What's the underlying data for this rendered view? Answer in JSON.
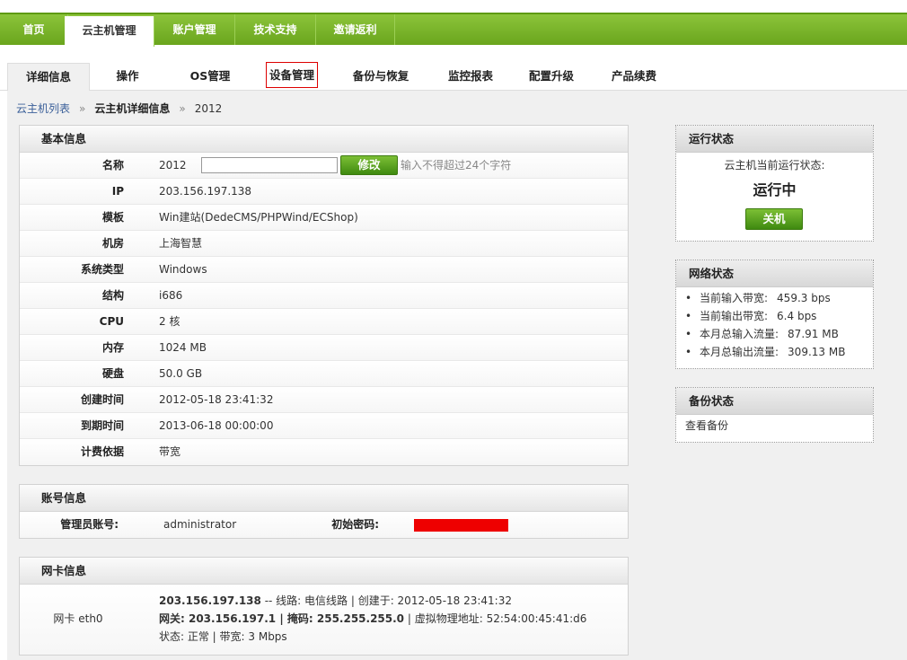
{
  "topnav": {
    "items": [
      {
        "label": "首页"
      },
      {
        "label": "云主机管理"
      },
      {
        "label": "账户管理"
      },
      {
        "label": "技术支持"
      },
      {
        "label": "邀请返利"
      }
    ]
  },
  "tabs": [
    {
      "label": "详细信息"
    },
    {
      "label": "操作"
    },
    {
      "label": "OS管理"
    },
    {
      "label": "设备管理"
    },
    {
      "label": "备份与恢复"
    },
    {
      "label": "监控报表"
    },
    {
      "label": "配置升级"
    },
    {
      "label": "产品续费"
    }
  ],
  "breadcrumb": {
    "root": "云主机列表",
    "sep": "»",
    "detail": "云主机详细信息",
    "current": "2012"
  },
  "basic": {
    "title": "基本信息",
    "name_label": "名称",
    "name_value": "2012",
    "name_input": "",
    "modify_button": "修改",
    "hint": "输入不得超过24个字符",
    "rows": [
      {
        "label": "IP",
        "value": "203.156.197.138"
      },
      {
        "label": "模板",
        "value": "Win建站(DedeCMS/PHPWind/ECShop)"
      },
      {
        "label": "机房",
        "value": "上海智慧"
      },
      {
        "label": "系统类型",
        "value": "Windows"
      },
      {
        "label": "结构",
        "value": "i686"
      },
      {
        "label": "CPU",
        "value": "2 核"
      },
      {
        "label": "内存",
        "value": "1024 MB"
      },
      {
        "label": "硬盘",
        "value": "50.0 GB"
      },
      {
        "label": "创建时间",
        "value": "2012-05-18 23:41:32"
      },
      {
        "label": "到期时间",
        "value": "2013-06-18 00:00:00"
      },
      {
        "label": "计费依据",
        "value": "带宽"
      }
    ]
  },
  "account": {
    "title": "账号信息",
    "admin_label": "管理员账号:",
    "admin_value": "administrator",
    "pwd_label": "初始密码:"
  },
  "nic": {
    "title": "网卡信息",
    "label": "网卡 eth0",
    "line1_ip": "203.156.197.138",
    "line1_rest": " -- 线路: 电信线路 | 创建于: 2012-05-18 23:41:32",
    "line2_bold": "网关: 203.156.197.1 | 掩码: 255.255.255.0",
    "line2_rest": " | 虚拟物理地址: 52:54:00:45:41:d6",
    "line3": "状态: 正常 | 带宽: 3 Mbps"
  },
  "run_status": {
    "title": "运行状态",
    "caption": "云主机当前运行状态:",
    "state": "运行中",
    "button": "关机"
  },
  "net_status": {
    "title": "网络状态",
    "items": [
      {
        "label": "当前输入带宽:",
        "value": "459.3 bps"
      },
      {
        "label": "当前输出带宽:",
        "value": "6.4 bps"
      },
      {
        "label": "本月总输入流量:",
        "value": "87.91 MB"
      },
      {
        "label": "本月总输出流量:",
        "value": "309.13 MB"
      }
    ]
  },
  "backup_status": {
    "title": "备份状态",
    "link": "查看备份"
  },
  "colors": {
    "nav_green": "#6aa51d",
    "button_green": "#3f8a10",
    "password_mask": "#ee0000",
    "breadcrumb_link": "#3a5f99"
  }
}
